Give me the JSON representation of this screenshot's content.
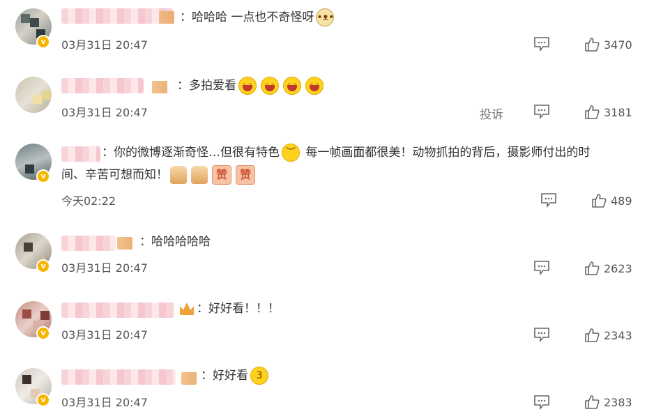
{
  "comments": [
    {
      "text_prefix": "：哈哈哈 一点也不奇怪呀",
      "time": "03月31日 20:47",
      "likes": "3470",
      "emojis": [
        "doge"
      ]
    },
    {
      "text_prefix": "：多拍爱看",
      "time": "03月31日 20:47",
      "likes": "3181",
      "report": "投诉",
      "emojis": [
        "laugh",
        "laugh",
        "laugh",
        "laugh"
      ]
    },
    {
      "text_line1": "：你的微博逐渐奇怪…但很有特色",
      "text_line1b": "每一帧画面都很美！动物抓拍的背后，摄影师付出的时",
      "text_line2": "间、辛苦可想而知！",
      "time": "今天02:22",
      "likes": "489",
      "badge": "赞"
    },
    {
      "text_prefix": "：哈哈哈哈哈",
      "time": "03月31日 20:47",
      "likes": "2623"
    },
    {
      "text_prefix": "：好好看！！！",
      "time": "03月31日 20:47",
      "likes": "2343"
    },
    {
      "text_prefix": "：好好看",
      "time": "03月31日 20:47",
      "likes": "2383"
    }
  ],
  "icons": {
    "comment": "comment-bubble-icon",
    "like": "thumbs-up-icon",
    "verified": "verified-v-badge-icon"
  },
  "colors": {
    "verified": "#f7b500",
    "emoji": "#ffd21f",
    "text": "#333333",
    "meta": "#555555"
  },
  "verified_mark": "v"
}
